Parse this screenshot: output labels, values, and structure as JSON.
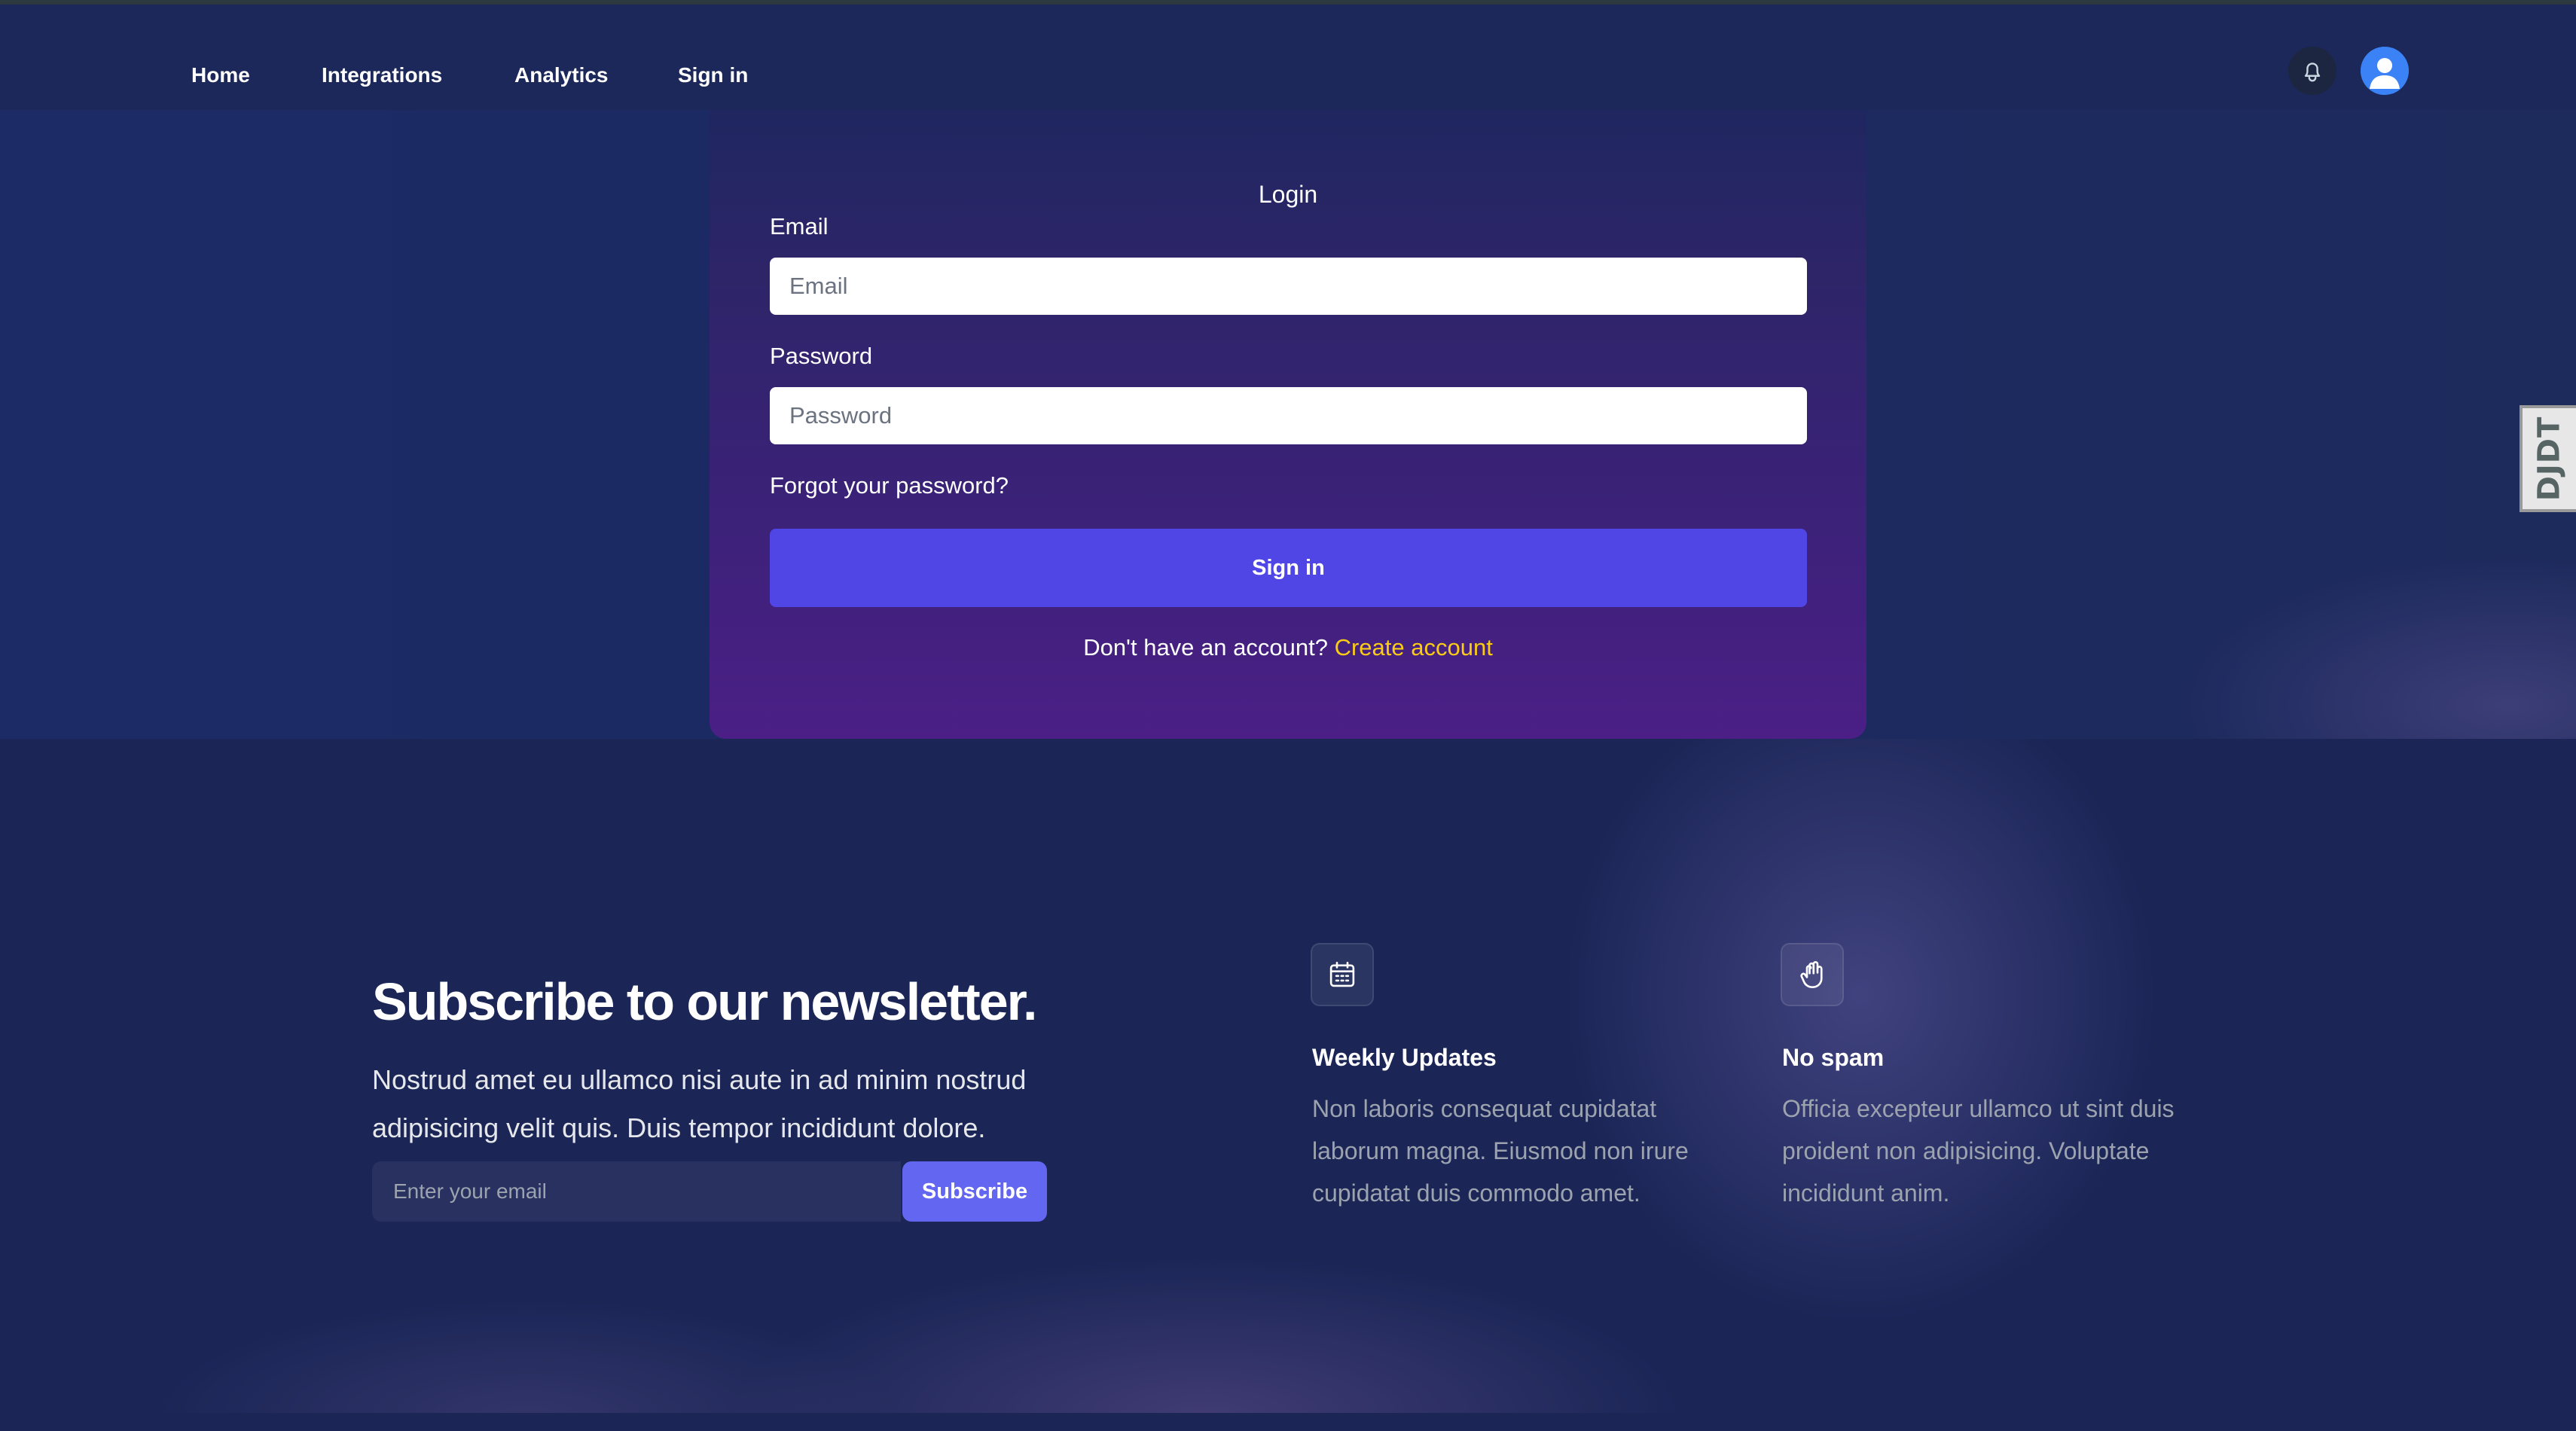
{
  "nav": {
    "links": [
      {
        "label": "Home"
      },
      {
        "label": "Integrations"
      },
      {
        "label": "Analytics"
      },
      {
        "label": "Sign in"
      }
    ],
    "bell_icon": "bell-icon",
    "avatar_icon": "user-avatar-icon"
  },
  "debug_toolbar": {
    "label": "DJDT"
  },
  "login": {
    "title": "Login",
    "email_label": "Email",
    "email_placeholder": "Email",
    "email_value": "",
    "password_label": "Password",
    "password_placeholder": "Password",
    "password_value": "",
    "forgot_label": "Forgot your password?",
    "submit_label": "Sign in",
    "no_account_text": "Don't have an account?",
    "create_account_label": "Create account"
  },
  "newsletter": {
    "heading": "Subscribe to our newsletter.",
    "description": "Nostrud amet eu ullamco nisi aute in ad minim nostrud adipisicing velit quis. Duis tempor incididunt dolore.",
    "email_placeholder": "Enter your email",
    "email_value": "",
    "subscribe_label": "Subscribe",
    "features": [
      {
        "icon": "calendar-icon",
        "title": "Weekly Updates",
        "text": "Non laboris consequat cupidatat laborum magna. Eiusmod non irure cupidatat duis commodo amet."
      },
      {
        "icon": "hand-raised-icon",
        "title": "No spam",
        "text": "Officia excepteur ullamco ut sint duis proident non adipisicing. Voluptate incididunt anim."
      }
    ]
  },
  "colors": {
    "accent": "#4f46e5",
    "subscribe_button": "#6366f1",
    "create_account_link": "#facc15",
    "page_background": "#1b2657"
  }
}
